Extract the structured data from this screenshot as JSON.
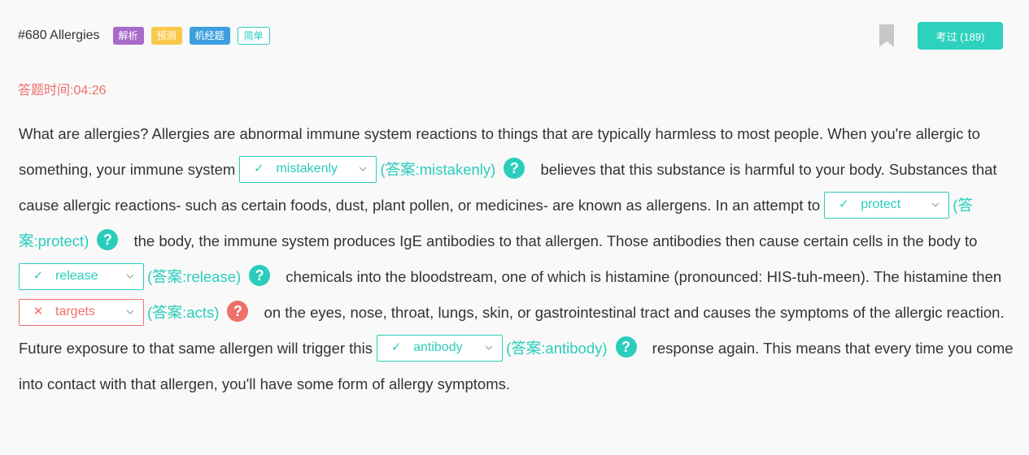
{
  "header": {
    "title": "#680 Allergies",
    "tags": [
      "解析",
      "预测",
      "机经题",
      "简单"
    ],
    "kaoguo_label": "考过 (189)"
  },
  "timer": {
    "label": "答题时间:",
    "value": "04:26"
  },
  "passage": {
    "t1": "What are allergies? Allergies are abnormal immune system reactions to things that are typically harmless to most people. When you're allergic to something, your immune system",
    "t2": "believes that this substance is harmful to your body. Substances that cause allergic reactions- such as certain foods, dust, plant pollen, or medicines- are known as allergens. In an attempt to",
    "t3": "the body, the immune system produces IgE antibodies to that allergen. Those antibodies then cause certain cells in the body to",
    "t4": "chemicals into the bloodstream, one of which is histamine (pronounced: HIS-tuh-meen). The histamine then",
    "t5": "on the eyes, nose, throat, lungs, skin, or gastrointestinal tract and causes the symptoms of the allergic reaction. Future exposure to that same allergen will trigger this",
    "t6": "response again. This means that every time you come into contact with that allergen, you'll have some form of allergy symptoms."
  },
  "blanks": [
    {
      "selected": "mistakenly",
      "answer": "(答案:mistakenly)",
      "status": "correct"
    },
    {
      "selected": "protect",
      "answer": "(答案:protect)",
      "status": "correct"
    },
    {
      "selected": "release",
      "answer": "(答案:release)",
      "status": "correct"
    },
    {
      "selected": "targets",
      "answer": "(答案:acts)",
      "status": "wrong"
    },
    {
      "selected": "antibody",
      "answer": "(答案:antibody)",
      "status": "correct"
    }
  ],
  "marks": {
    "correct": "✓",
    "wrong": "✕",
    "help": "?"
  },
  "colors": {
    "accent": "#2acdbb",
    "error": "#ef6f6a",
    "button": "#2ed1bd"
  },
  "icons": [
    "bookmark-icon",
    "check-icon",
    "cross-icon",
    "chevron-down-icon",
    "question-icon"
  ]
}
